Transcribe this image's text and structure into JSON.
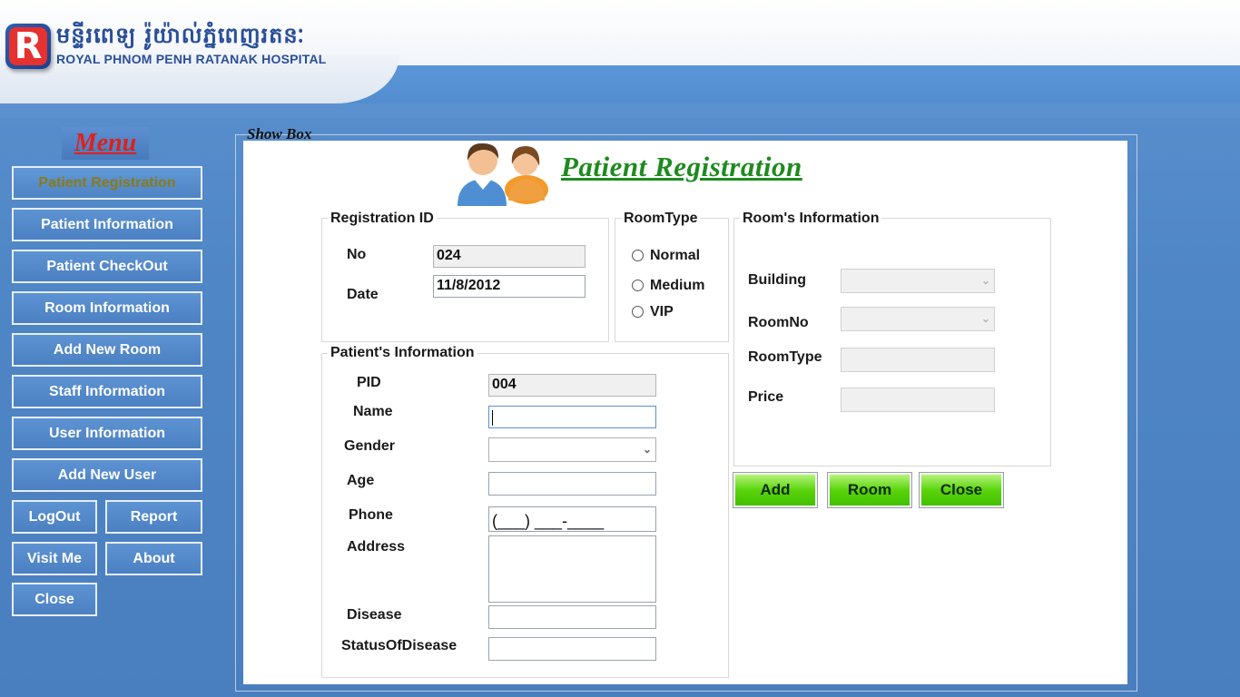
{
  "header": {
    "logo_letter": "R",
    "khmer_name": "មន្ទីរពេទ្យ រ៉ូយ៉ាល់ភ្នំពេញរតនៈ",
    "hospital_name": "ROYAL PHNOM PENH RATANAK HOSPITAL"
  },
  "menu": {
    "title": "Menu",
    "items": [
      {
        "label": "Patient Registration",
        "active": true
      },
      {
        "label": "Patient Information"
      },
      {
        "label": "Patient CheckOut"
      },
      {
        "label": "Room Information"
      },
      {
        "label": "Add New Room"
      },
      {
        "label": "Staff Information"
      },
      {
        "label": "User Information"
      },
      {
        "label": "Add New User"
      }
    ],
    "logout": "LogOut",
    "report": "Report",
    "visit_me": "Visit Me",
    "about": "About",
    "close": "Close"
  },
  "showbox": {
    "legend": "Show Box",
    "title": "Patient Registration",
    "registration": {
      "group_label": "Registration ID",
      "no_label": "No",
      "no_value": "024",
      "date_label": "Date",
      "date_value": "11/8/2012"
    },
    "roomtype": {
      "group_label": "RoomType",
      "options": [
        "Normal",
        "Medium",
        "VIP"
      ]
    },
    "room_info": {
      "group_label": "Room's Information",
      "building_label": "Building",
      "building_value": "",
      "roomno_label": "RoomNo",
      "roomno_value": "",
      "roomtype_label": "RoomType",
      "roomtype_value": "",
      "price_label": "Price",
      "price_value": ""
    },
    "patient": {
      "group_label": "Patient's Information",
      "pid_label": "PID",
      "pid_value": "004",
      "name_label": "Name",
      "name_value": "",
      "gender_label": "Gender",
      "gender_value": "",
      "age_label": "Age",
      "age_value": "",
      "phone_label": "Phone",
      "phone_mask": "(___) ___-____",
      "address_label": "Address",
      "address_value": "",
      "disease_label": "Disease",
      "disease_value": "",
      "status_label": "StatusOfDisease",
      "status_value": ""
    },
    "buttons": {
      "add": "Add",
      "room": "Room",
      "close": "Close"
    }
  },
  "colors": {
    "background_blue": "#4f86c6",
    "title_green": "#1f8a1f",
    "menu_red": "#e0201a",
    "button_green": "#5ad40c"
  }
}
